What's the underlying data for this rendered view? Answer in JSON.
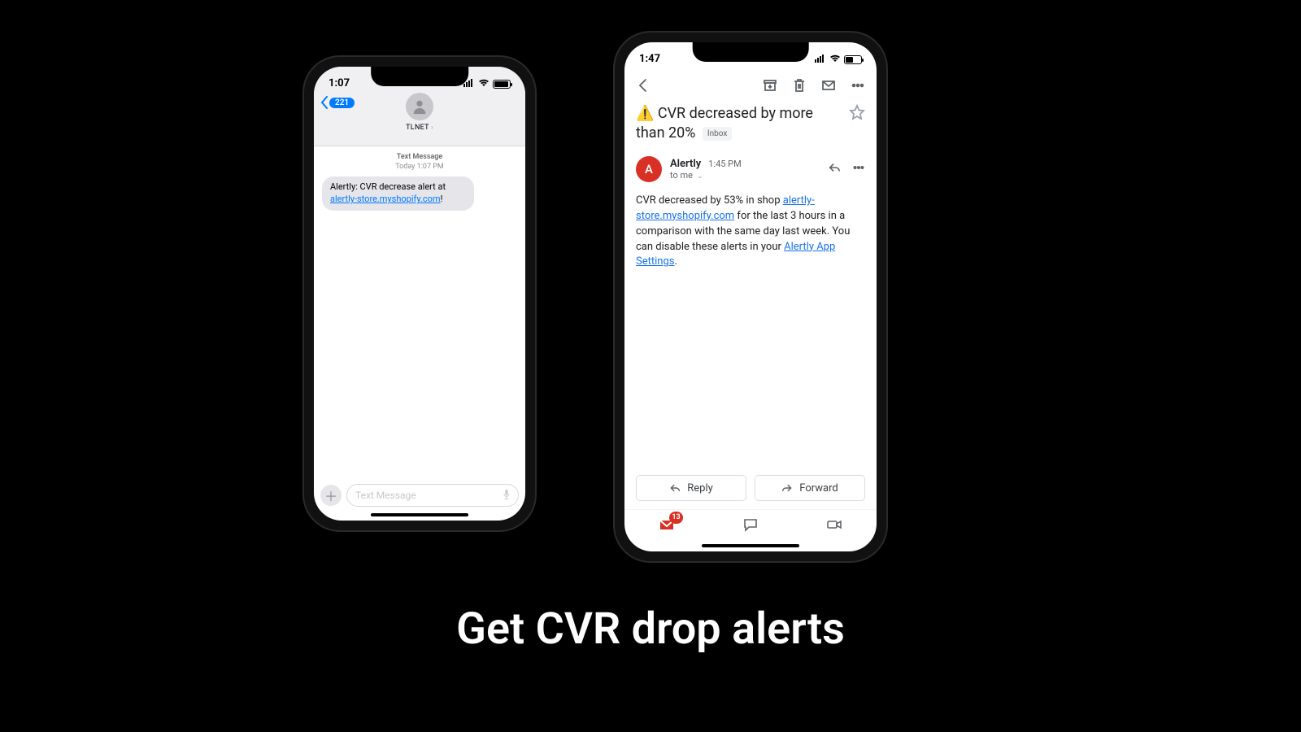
{
  "caption": "Get CVR drop alerts",
  "sms": {
    "status_time": "1:07",
    "back_count": "221",
    "contact_name": "TLNET",
    "meta_label": "Text Message",
    "meta_time": "Today 1:07 PM",
    "bubble_text_1": "Alertly: CVR decrease alert at ",
    "bubble_link": "alertly-store.myshopify.com",
    "bubble_text_2": "!",
    "input_placeholder": "Text Message"
  },
  "email": {
    "status_time": "1:47",
    "subject_prefix": "⚠️ CVR decreased by more than 20%",
    "inbox_label": "Inbox",
    "sender_initial": "A",
    "sender_name": "Alertly",
    "sender_time": "1:45 PM",
    "to_line": "to me",
    "body_1": "CVR decreased by 53% in shop ",
    "body_link1": "alertly-store.myshopify.com",
    "body_2": " for the last 3 hours in a comparison with the same day last week. You can disable these alerts in your ",
    "body_link2": "Alertly App Settings",
    "body_3": ".",
    "reply_label": "Reply",
    "forward_label": "Forward",
    "nav_badge": "13"
  }
}
